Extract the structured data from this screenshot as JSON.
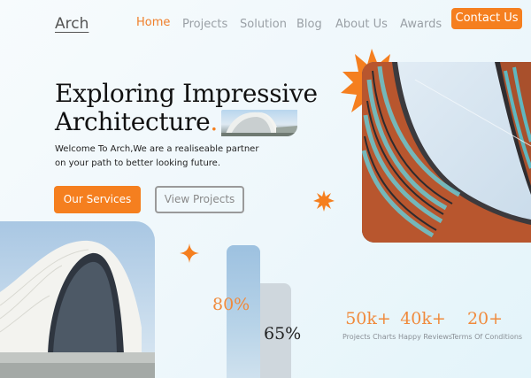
{
  "brand": {
    "logo": "Arch"
  },
  "nav": {
    "items": [
      {
        "label": "Home",
        "active": true
      },
      {
        "label": "Projects"
      },
      {
        "label": "Solution"
      },
      {
        "label": "Blog"
      },
      {
        "label": "About Us"
      },
      {
        "label": "Awards"
      }
    ],
    "contact_label": "Contact Us"
  },
  "hero": {
    "title_line1": "Exploring Impressive",
    "title_line2": "Architecture",
    "title_dot": ".",
    "description": "Welcome To Arch,We are a realiseable partner on your path to better looking future.",
    "primary_button": "Our Services",
    "secondary_button": "View Projects"
  },
  "progress": [
    {
      "value": 80,
      "label": "80%"
    },
    {
      "value": 65,
      "label": "65%"
    }
  ],
  "stats": [
    {
      "value": "50k+",
      "label": "Projects Charts"
    },
    {
      "value": "40k+",
      "label": "Happy Reviews"
    },
    {
      "value": "20+",
      "label": "Terms Of Conditions"
    }
  ],
  "colors": {
    "accent": "#f57f1f",
    "nav_text": "#9aa0a6",
    "bar_blue": "#9dc1e0",
    "bar_gray": "#cfd7dd"
  }
}
